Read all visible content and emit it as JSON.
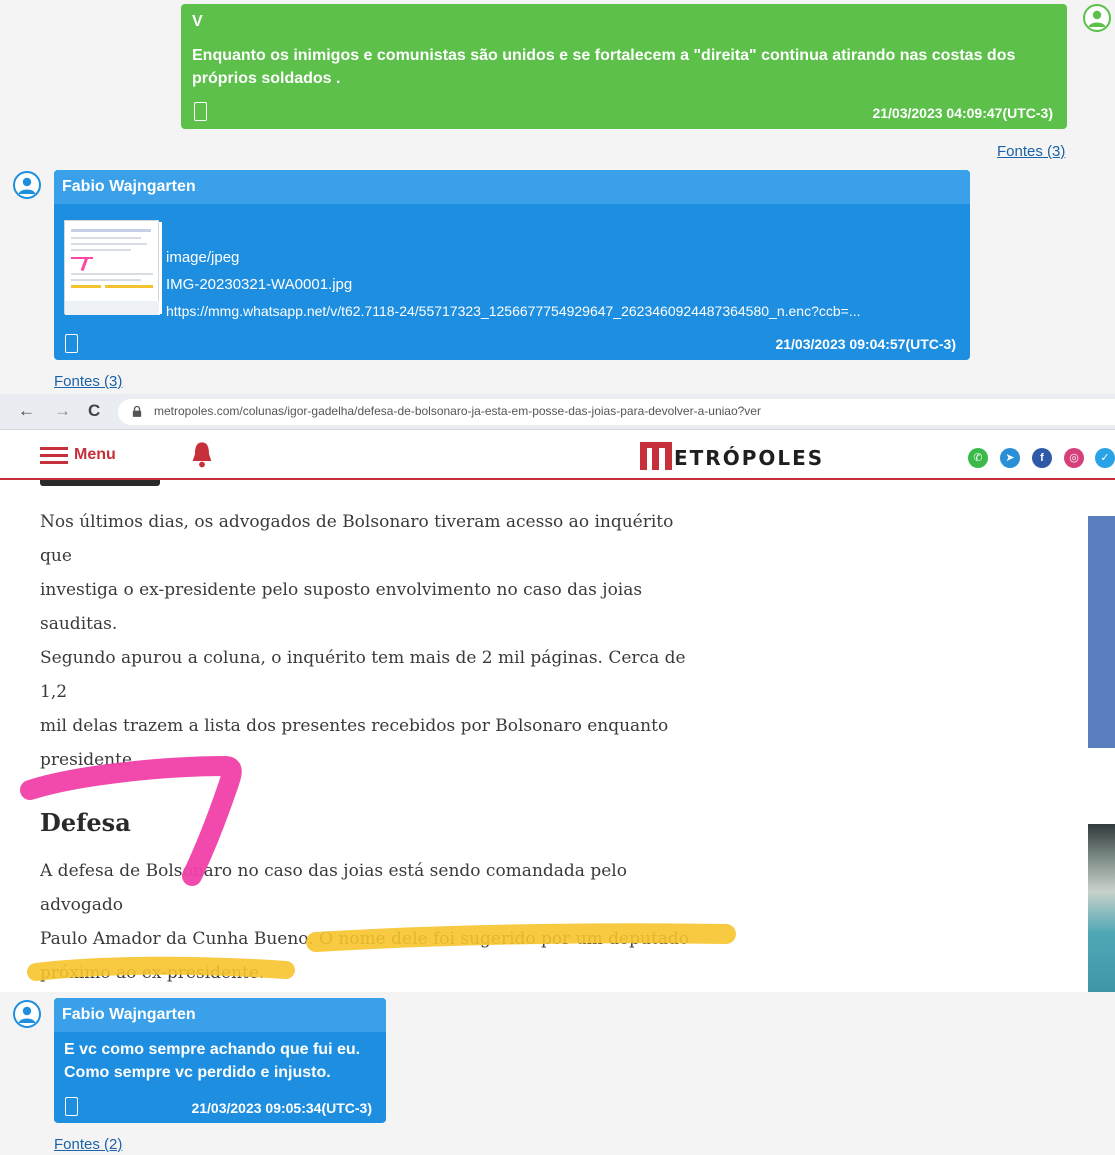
{
  "chat": {
    "messages": [
      {
        "sender": "V",
        "text": "Enquanto os inimigos e comunistas  são unidos e se fortalecem a  \"direita\"  continua atirando nas costas dos próprios soldados .",
        "timestamp": "21/03/2023 04:09:47(UTC-3)",
        "sources": "Fontes (3)",
        "color": "#5cc04a"
      },
      {
        "sender": "Fabio Wajngarten",
        "attachment": {
          "mime": "image/jpeg",
          "filename": "IMG-20230321-WA0001.jpg",
          "url": "https://mmg.whatsapp.net/v/t62.7118-24/55717323_1256677754929647_2623460924487364580_n.enc?ccb=..."
        },
        "timestamp": "21/03/2023 09:04:57(UTC-3)",
        "sources": "Fontes (3)",
        "color": "#1e8fe0"
      },
      {
        "sender": "Fabio Wajngarten",
        "text_line1": "E vc como sempre achando que fui eu.",
        "text_line2": "Como sempre vc perdido e injusto.",
        "timestamp": "21/03/2023 09:05:34(UTC-3)",
        "sources": "Fontes (2)",
        "color": "#1e8fe0"
      }
    ]
  },
  "browser": {
    "url": "metropoles.com/colunas/igor-gadelha/defesa-de-bolsonaro-ja-esta-em-posse-das-joias-para-devolver-a-uniao?ver",
    "back_glyph": "←",
    "forward_glyph": "→",
    "reload_glyph": "C",
    "menu_label": "Menu",
    "logo_text": "ETRÓPOLES",
    "brand_color": "#c5303a",
    "social": [
      {
        "icon": "whatsapp-icon",
        "glyph": "✆",
        "color": "#3bba4a"
      },
      {
        "icon": "telegram-icon",
        "glyph": "➤",
        "color": "#2a8fd6"
      },
      {
        "icon": "facebook-icon",
        "glyph": "f",
        "color": "#2f5aa8"
      },
      {
        "icon": "instagram-icon",
        "glyph": "◎",
        "color": "#d6407a"
      },
      {
        "icon": "twitter-icon",
        "glyph": "✓",
        "color": "#2aa3e6"
      }
    ]
  },
  "article": {
    "para1_l1": "Nos últimos dias, os advogados de Bolsonaro tiveram acesso ao inquérito que",
    "para1_l2": "investiga o ex-presidente pelo suposto envolvimento no caso das joias",
    "para1_l3": "sauditas.",
    "para2_l1": "Segundo apurou a coluna, o inquérito tem mais de 2 mil páginas. Cerca de 1,2",
    "para2_l2": "mil delas trazem a lista dos presentes recebidos por Bolsonaro enquanto",
    "para2_l3": "presidente.",
    "heading": "Defesa",
    "para3_l1": "A defesa de Bolsonaro no caso das joias está sendo comandada pelo advogado",
    "para3_l2": "Paulo Amador da Cunha Bueno. O nome dele foi sugerido por um deputado",
    "para3_l3": "próximo ao ex-presidente."
  }
}
